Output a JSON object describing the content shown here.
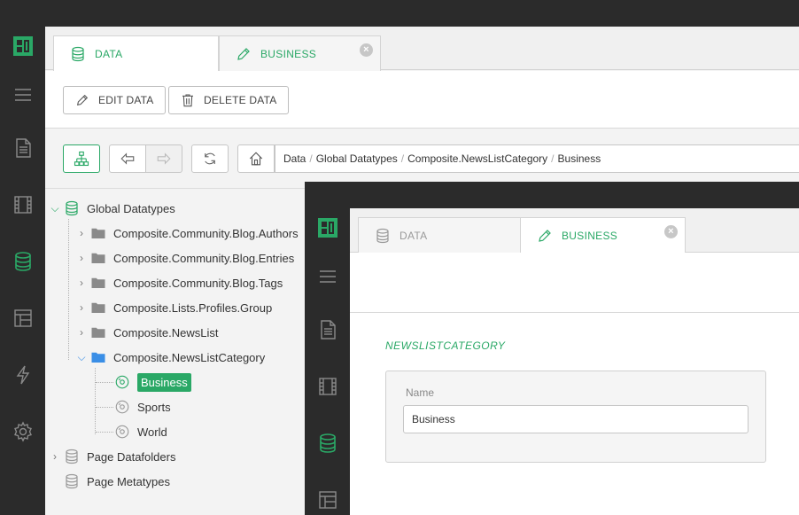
{
  "colors": {
    "accent": "#2aa866",
    "sidebar": "#2b2b2b"
  },
  "sidebar": {
    "icons": [
      "logo-icon",
      "menu-icon",
      "pages-icon",
      "media-icon",
      "data-icon",
      "layout-icon",
      "functions-icon",
      "settings-icon"
    ]
  },
  "tabs": [
    {
      "label": "DATA",
      "icon": "database-icon",
      "active": true
    },
    {
      "label": "BUSINESS",
      "icon": "pencil-icon",
      "active": false,
      "close": "×"
    }
  ],
  "toolbar": {
    "edit_label": "EDIT DATA",
    "delete_label": "DELETE DATA"
  },
  "breadcrumb": [
    "Data",
    "Global Datatypes",
    "Composite.NewsListCategory",
    "Business"
  ],
  "tree": {
    "root": "Global Datatypes",
    "folders": [
      "Composite.Community.Blog.Authors",
      "Composite.Community.Blog.Entries",
      "Composite.Community.Blog.Tags",
      "Composite.Lists.Profiles.Group",
      "Composite.NewsList",
      "Composite.NewsListCategory"
    ],
    "items": [
      "Business",
      "Sports",
      "World"
    ],
    "other_roots": [
      "Page Datafolders",
      "Page Metatypes"
    ]
  },
  "overlay": {
    "tabs": [
      {
        "label": "DATA",
        "active": false
      },
      {
        "label": "BUSINESS",
        "active": true,
        "close": "×"
      }
    ],
    "section_title": "NEWSLISTCATEGORY",
    "field_label": "Name",
    "field_value": "Business"
  }
}
